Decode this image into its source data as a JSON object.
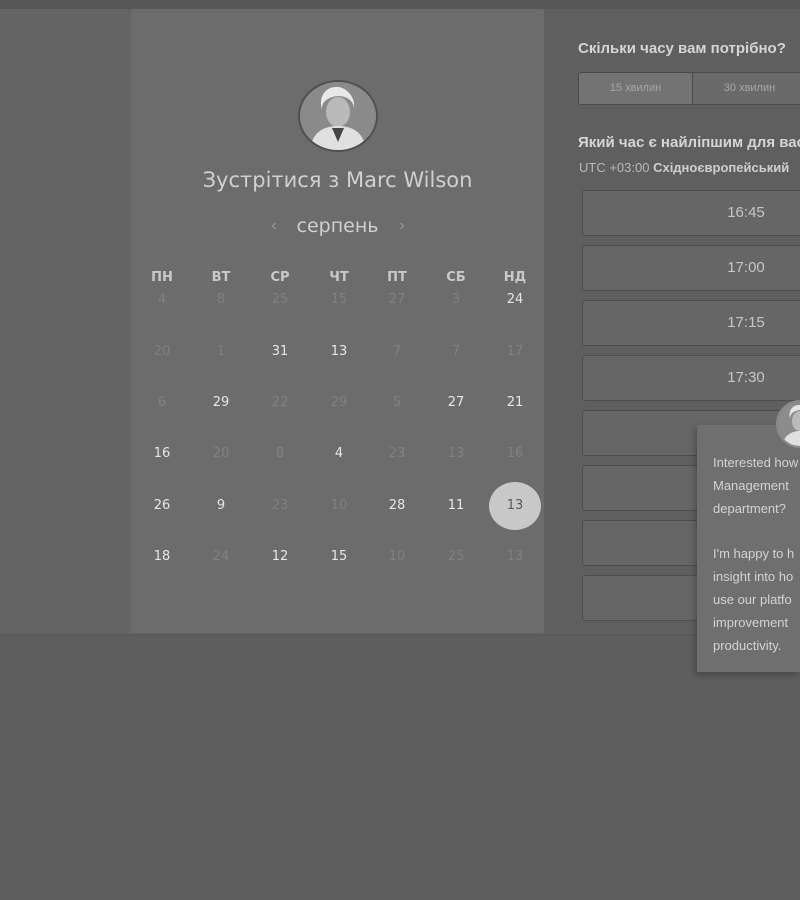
{
  "host": {
    "title": "Зустрітися з Marc Wilson"
  },
  "calendar": {
    "month": "серпень",
    "prev_icon": "chevron-left-icon",
    "next_icon": "chevron-right-icon",
    "weekdays": [
      "ПН",
      "ВТ",
      "СР",
      "ЧТ",
      "ПТ",
      "СБ",
      "НД"
    ],
    "weeks": [
      [
        {
          "d": "4",
          "a": false
        },
        {
          "d": "8",
          "a": false
        },
        {
          "d": "25",
          "a": false
        },
        {
          "d": "15",
          "a": false
        },
        {
          "d": "27",
          "a": false
        },
        {
          "d": "3",
          "a": false
        },
        {
          "d": "24",
          "a": true
        }
      ],
      [
        {
          "d": "20",
          "a": false
        },
        {
          "d": "1",
          "a": false
        },
        {
          "d": "31",
          "a": true
        },
        {
          "d": "13",
          "a": true
        },
        {
          "d": "7",
          "a": false
        },
        {
          "d": "7",
          "a": false
        },
        {
          "d": "17",
          "a": false
        }
      ],
      [
        {
          "d": "6",
          "a": false
        },
        {
          "d": "29",
          "a": true
        },
        {
          "d": "22",
          "a": false
        },
        {
          "d": "29",
          "a": false
        },
        {
          "d": "5",
          "a": false
        },
        {
          "d": "27",
          "a": true
        },
        {
          "d": "21",
          "a": true
        }
      ],
      [
        {
          "d": "16",
          "a": true
        },
        {
          "d": "20",
          "a": false
        },
        {
          "d": "8",
          "a": false
        },
        {
          "d": "4",
          "a": true
        },
        {
          "d": "23",
          "a": false
        },
        {
          "d": "13",
          "a": false
        },
        {
          "d": "16",
          "a": false
        }
      ],
      [
        {
          "d": "26",
          "a": true
        },
        {
          "d": "9",
          "a": true
        },
        {
          "d": "23",
          "a": false
        },
        {
          "d": "10",
          "a": false
        },
        {
          "d": "28",
          "a": true
        },
        {
          "d": "11",
          "a": true
        },
        {
          "d": "13",
          "a": true,
          "selected": true
        }
      ],
      [
        {
          "d": "18",
          "a": true
        },
        {
          "d": "24",
          "a": false
        },
        {
          "d": "12",
          "a": true
        },
        {
          "d": "15",
          "a": true
        },
        {
          "d": "10",
          "a": false
        },
        {
          "d": "25",
          "a": false
        },
        {
          "d": "13",
          "a": false
        }
      ]
    ]
  },
  "duration": {
    "question": "Скільки часу вам потрібно?",
    "options": [
      "15 хвилин",
      "30 хвилин"
    ],
    "selected_index": 0
  },
  "time_select": {
    "question": "Який час є найліпшим для вас?",
    "tz_offset": "UTC +03:00",
    "tz_name": "Східноєвропейський",
    "slots": [
      "16:45",
      "17:00",
      "17:15",
      "17:30",
      "",
      "",
      "",
      ""
    ]
  },
  "chat": {
    "lines": [
      "Interested how",
      "Management",
      "department?",
      "",
      "I'm happy to h",
      "insight into ho",
      "use our platfo",
      "improvement",
      "productivity."
    ]
  },
  "colors": {
    "overlay_background": "#5e5e5e",
    "card_background": "#6c6c6c",
    "selected_day": "#c8c8c8"
  }
}
